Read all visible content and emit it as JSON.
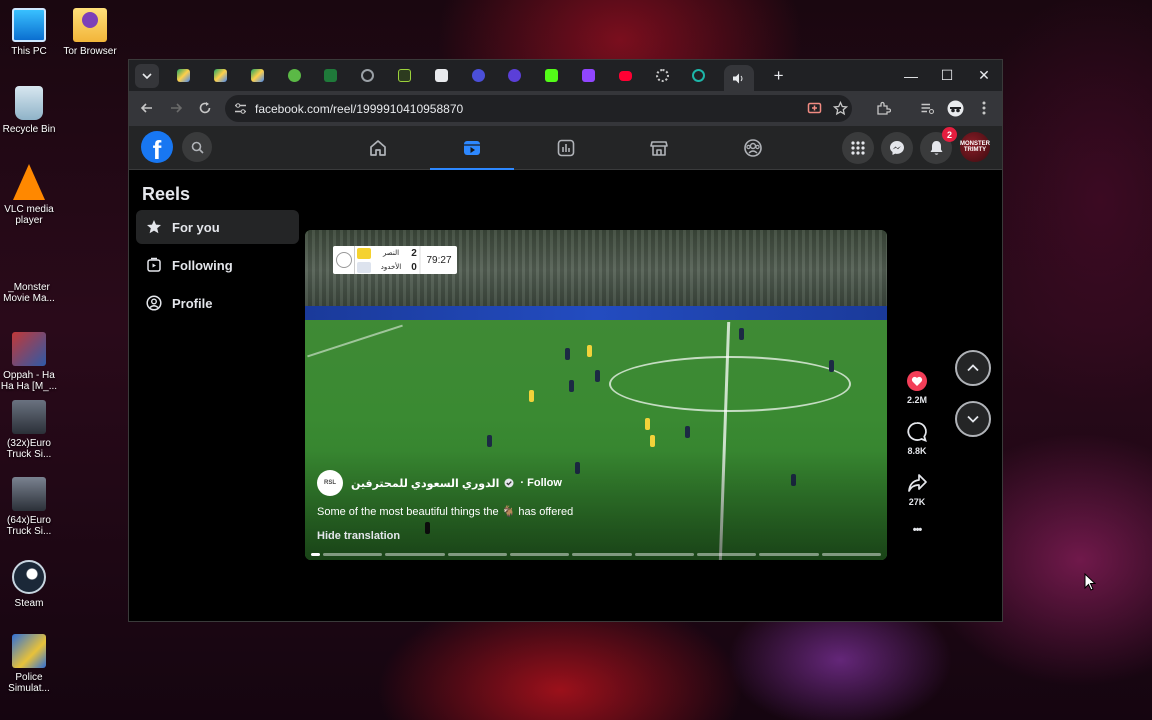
{
  "desktop": {
    "icons": [
      {
        "label": "This PC",
        "icon": "monitor-icon"
      },
      {
        "label": "Tor Browser",
        "icon": "folder-icon"
      },
      {
        "label": "Recycle Bin",
        "icon": "recycle-bin-icon"
      },
      {
        "label": "VLC media player",
        "icon": "vlc-cone-icon"
      },
      {
        "label": "_Monster Movie Ma...",
        "icon": "movie-icon"
      },
      {
        "label": "Oppah - Ha Ha Ha [M_...",
        "icon": "video-file-icon"
      },
      {
        "label": "(32x)Euro Truck Si...",
        "icon": "truck-game-icon"
      },
      {
        "label": "(64x)Euro Truck Si...",
        "icon": "truck-game-icon"
      },
      {
        "label": "Steam",
        "icon": "steam-icon"
      },
      {
        "label": "Police Simulat...",
        "icon": "police-game-icon"
      }
    ]
  },
  "browser": {
    "url": "facebook.com/reel/1999910410958870",
    "new_tab_glyph": "+",
    "minimize_glyph": "—",
    "maximize_glyph": "☐",
    "close_glyph": "✕"
  },
  "facebook": {
    "logo_letter": "f",
    "notification_count": "2",
    "avatar_text": "MONSTER TRIMTY"
  },
  "sidebar": {
    "title": "Reels",
    "items": [
      {
        "label": "For you",
        "icon": "star-icon"
      },
      {
        "label": "Following",
        "icon": "following-icon"
      },
      {
        "label": "Profile",
        "icon": "profile-icon"
      }
    ]
  },
  "video": {
    "scoreboard": {
      "team_top": "النصر",
      "team_bottom": "الأخدود",
      "score_top": "2",
      "score_bottom": "0",
      "clock": "79:27"
    },
    "author": "الدوري السعودي للمحترفين",
    "author_logo_text": "RSL",
    "follow_label": "· Follow",
    "caption": "Some of the most beautiful things the 🐐 has offered",
    "hide_translation": "Hide translation"
  },
  "actions": {
    "likes": "2.2M",
    "comments": "8.8K",
    "shares": "27K",
    "more_glyph": "•••"
  },
  "colors": {
    "facebook_blue": "#1877f2",
    "active_tab_blue": "#2d88ff",
    "like_red": "#f33e58",
    "badge_red": "#e41e3f"
  }
}
